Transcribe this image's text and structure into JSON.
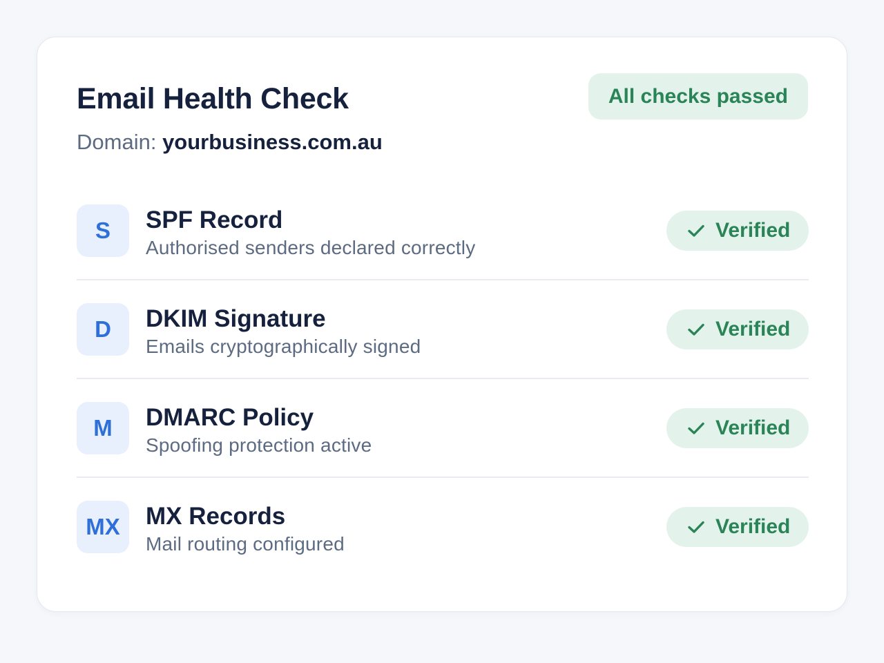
{
  "header": {
    "title": "Email Health Check",
    "domain_label": "Domain:",
    "domain_value": "yourbusiness.com.au",
    "overall_status": "All checks passed"
  },
  "checks": [
    {
      "icon_letter": "S",
      "name": "SPF Record",
      "description": "Authorised senders declared correctly",
      "status": "Verified",
      "status_icon": "checkmark-icon"
    },
    {
      "icon_letter": "D",
      "name": "DKIM Signature",
      "description": "Emails cryptographically signed",
      "status": "Verified",
      "status_icon": "checkmark-icon"
    },
    {
      "icon_letter": "M",
      "name": "DMARC Policy",
      "description": "Spoofing protection active",
      "status": "Verified",
      "status_icon": "checkmark-icon"
    },
    {
      "icon_letter": "MX",
      "name": "MX Records",
      "description": "Mail routing configured",
      "status": "Verified",
      "status_icon": "checkmark-icon"
    }
  ],
  "colors": {
    "page_background": "#f5f7fb",
    "card_background": "#ffffff",
    "heading_text": "#15213d",
    "muted_text": "#5d6b82",
    "success_background": "#e3f3eb",
    "success_text": "#2a8457",
    "icon_tile_background": "#e8f0fd",
    "icon_tile_text": "#2e6fd8"
  }
}
